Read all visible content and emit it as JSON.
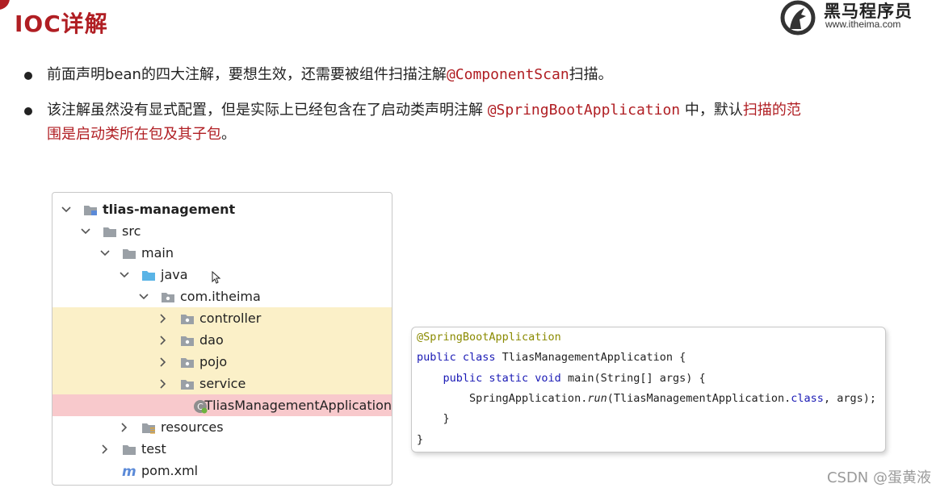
{
  "slide": {
    "title": "IOC详解",
    "logo": {
      "name": "黑马程序员",
      "url": "www.itheima.com"
    }
  },
  "bullets": [
    {
      "parts": [
        {
          "text": "前面声明bean的四大注解，要想生效，还需要被组件扫描注解",
          "style": "plain"
        },
        {
          "text": "@ComponentScan",
          "style": "mono-red"
        },
        {
          "text": "扫描。",
          "style": "plain"
        }
      ]
    },
    {
      "line1": [
        {
          "text": "该注解虽然没有显式配置，但是实际上已经包含在了启动类声明注解 ",
          "style": "plain"
        },
        {
          "text": "@SpringBootApplication",
          "style": "mono-red"
        },
        {
          "text": " 中，默认",
          "style": "plain"
        },
        {
          "text": "扫描的范",
          "style": "red"
        }
      ],
      "line2": [
        {
          "text": "围是启动类所在包及其子包",
          "style": "red"
        },
        {
          "text": "。",
          "style": "plain"
        }
      ]
    }
  ],
  "tree": {
    "items": [
      {
        "label": "tlias-management",
        "level": 0,
        "chevron": "down",
        "icon": "module",
        "bold": true,
        "highlight": ""
      },
      {
        "label": "src",
        "level": 1,
        "chevron": "down",
        "icon": "folder",
        "bold": false,
        "highlight": ""
      },
      {
        "label": "main",
        "level": 2,
        "chevron": "down",
        "icon": "folder",
        "bold": false,
        "highlight": ""
      },
      {
        "label": "java",
        "level": 3,
        "chevron": "down",
        "icon": "source-folder",
        "bold": false,
        "highlight": ""
      },
      {
        "label": "com.itheima",
        "level": 4,
        "chevron": "down",
        "icon": "package",
        "bold": false,
        "highlight": ""
      },
      {
        "label": "controller",
        "level": 5,
        "chevron": "right",
        "icon": "package",
        "bold": false,
        "highlight": "yellow"
      },
      {
        "label": "dao",
        "level": 5,
        "chevron": "right",
        "icon": "package",
        "bold": false,
        "highlight": "yellow"
      },
      {
        "label": "pojo",
        "level": 5,
        "chevron": "right",
        "icon": "package",
        "bold": false,
        "highlight": "yellow"
      },
      {
        "label": "service",
        "level": 5,
        "chevron": "right",
        "icon": "package",
        "bold": false,
        "highlight": "yellow"
      },
      {
        "label": "TliasManagementApplication",
        "level": 6,
        "chevron": "none",
        "icon": "spring-class",
        "bold": false,
        "highlight": "red"
      },
      {
        "label": "resources",
        "level": 3,
        "chevron": "right",
        "icon": "resources-folder",
        "bold": false,
        "highlight": ""
      },
      {
        "label": "test",
        "level": 2,
        "chevron": "right",
        "icon": "folder",
        "bold": false,
        "highlight": ""
      },
      {
        "label": "pom.xml",
        "level": 2,
        "chevron": "none",
        "icon": "maven",
        "bold": false,
        "highlight": ""
      }
    ]
  },
  "code": {
    "lines": [
      [
        {
          "text": "@SpringBootApplication",
          "style": "ann"
        }
      ],
      [
        {
          "text": "public class ",
          "style": "kw"
        },
        {
          "text": "TliasManagementApplication {",
          "style": "plain"
        }
      ],
      [
        {
          "text": "    ",
          "style": "plain"
        },
        {
          "text": "public static void ",
          "style": "kw"
        },
        {
          "text": "main(String[] args) {",
          "style": "plain"
        }
      ],
      [
        {
          "text": "        SpringApplication.",
          "style": "plain"
        },
        {
          "text": "run",
          "style": "it"
        },
        {
          "text": "(TliasManagementApplication.",
          "style": "plain"
        },
        {
          "text": "class",
          "style": "kw"
        },
        {
          "text": ", args);",
          "style": "plain"
        }
      ],
      [
        {
          "text": "    }",
          "style": "plain"
        }
      ],
      [
        {
          "text": "}",
          "style": "plain"
        }
      ]
    ]
  },
  "watermark": "CSDN @蛋黄液",
  "colors": {
    "accent": "#b01e23",
    "keyword": "#1a1ab5",
    "annotation": "#8a8a00",
    "highlight_yellow": "#fbf0c8",
    "highlight_red": "#f8c9cc"
  }
}
